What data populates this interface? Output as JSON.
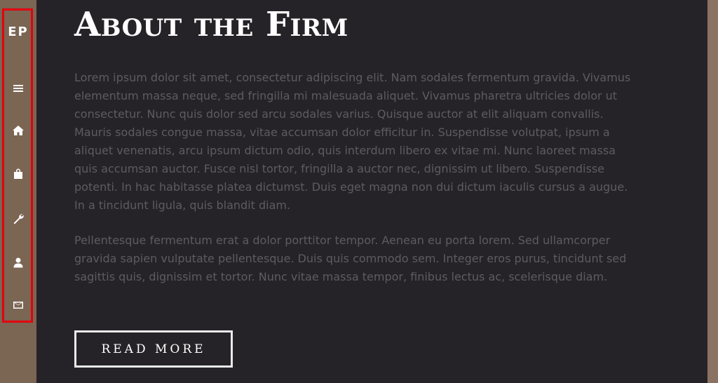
{
  "sidebar": {
    "logo": "EP",
    "items": [
      {
        "icon": "menu-icon"
      },
      {
        "icon": "home-icon"
      },
      {
        "icon": "shopping-bag-icon"
      },
      {
        "icon": "wrench-icon"
      },
      {
        "icon": "user-icon"
      },
      {
        "icon": "envelope-icon"
      }
    ]
  },
  "main": {
    "title": "About the Firm",
    "paragraphs": [
      "Lorem ipsum dolor sit amet, consectetur adipiscing elit. Nam sodales fermentum gravida. Vivamus elementum massa neque, sed fringilla mi malesuada aliquet. Vivamus pharetra ultricies dolor ut consectetur. Nunc quis dolor sed arcu sodales varius. Quisque auctor at elit aliquam convallis. Mauris sodales congue massa, vitae accumsan dolor efficitur in. Suspendisse volutpat, ipsum a aliquet venenatis, arcu ipsum dictum odio, quis interdum libero ex vitae mi. Nunc laoreet massa quis accumsan auctor. Fusce nisl tortor, fringilla a auctor nec, dignissim ut libero. Suspendisse potenti. In hac habitasse platea dictumst. Duis eget magna non dui dictum iaculis cursus a augue. In a tincidunt ligula, quis blandit diam.",
      "Pellentesque fermentum erat a dolor porttitor tempor. Aenean eu porta lorem. Sed ullamcorper gravida sapien vulputate pellentesque. Duis quis commodo sem. Integer eros purus, tincidunt sed sagittis quis, dignissim et tortor. Nunc vitae massa tempor, finibus lectus ac, scelerisque diam."
    ],
    "read_more_label": "READ MORE"
  },
  "colors": {
    "sidebar_bg": "#7b6553",
    "main_bg": "#252328",
    "highlight_border": "#e3000f",
    "body_text": "#5f5b60",
    "title_text": "#ffffff"
  }
}
